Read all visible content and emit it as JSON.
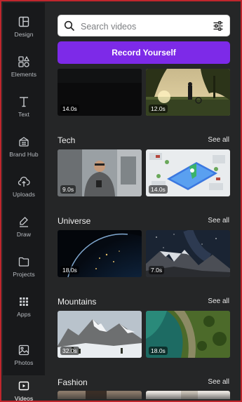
{
  "rail": [
    {
      "label": "Design",
      "icon": "design-icon"
    },
    {
      "label": "Elements",
      "icon": "elements-icon"
    },
    {
      "label": "Text",
      "icon": "text-icon"
    },
    {
      "label": "Brand Hub",
      "icon": "brand-hub-icon"
    },
    {
      "label": "Uploads",
      "icon": "uploads-icon"
    },
    {
      "label": "Draw",
      "icon": "draw-icon"
    },
    {
      "label": "Projects",
      "icon": "projects-icon"
    },
    {
      "label": "Apps",
      "icon": "apps-icon"
    },
    {
      "label": "Photos",
      "icon": "photos-icon"
    },
    {
      "label": "Videos",
      "icon": "videos-icon",
      "active": true
    }
  ],
  "search": {
    "placeholder": "Search videos"
  },
  "record_label": "Record Yourself",
  "see_all": "See all",
  "top_row": [
    {
      "duration": "14.0s"
    },
    {
      "duration": "12.0s"
    }
  ],
  "sections": [
    {
      "title": "Tech",
      "items": [
        {
          "duration": "9.0s"
        },
        {
          "duration": "14.0s"
        }
      ]
    },
    {
      "title": "Universe",
      "items": [
        {
          "duration": "18.0s"
        },
        {
          "duration": "7.0s"
        }
      ]
    },
    {
      "title": "Mountains",
      "items": [
        {
          "duration": "32.0s"
        },
        {
          "duration": "18.0s"
        }
      ]
    },
    {
      "title": "Fashion",
      "items": []
    }
  ],
  "colors": {
    "accent": "#7d2ae8",
    "rail_bg": "#18191b",
    "panel_bg": "#252627",
    "border": "#c0262d"
  }
}
